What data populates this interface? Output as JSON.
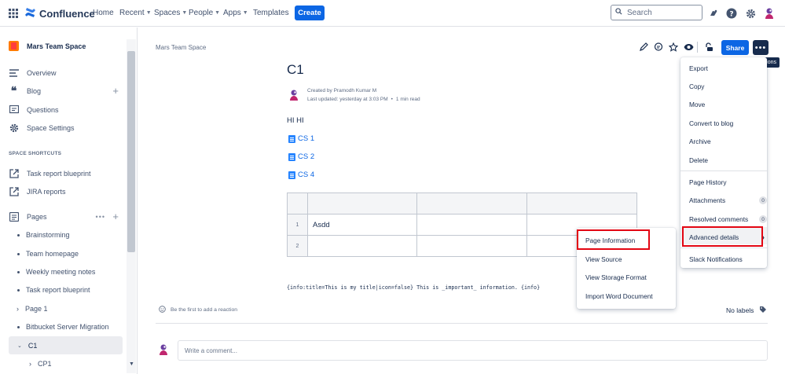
{
  "topbar": {
    "logo": "Confluence",
    "nav": [
      {
        "label": "Home",
        "dropdown": false
      },
      {
        "label": "Recent",
        "dropdown": true
      },
      {
        "label": "Spaces",
        "dropdown": true
      },
      {
        "label": "People",
        "dropdown": true
      },
      {
        "label": "Apps",
        "dropdown": true
      },
      {
        "label": "Templates",
        "dropdown": false
      }
    ],
    "create_label": "Create",
    "search_placeholder": "Search"
  },
  "sidebar": {
    "space_name": "Mars Team Space",
    "items": [
      {
        "label": "Overview",
        "icon": "overview-icon"
      },
      {
        "label": "Blog",
        "icon": "quote-icon"
      },
      {
        "label": "Questions",
        "icon": "questions-icon"
      },
      {
        "label": "Space Settings",
        "icon": "gear-icon"
      }
    ],
    "shortcuts_header": "SPACE SHORTCUTS",
    "shortcuts": [
      "Task report blueprint",
      "JIRA reports"
    ],
    "pages_label": "Pages",
    "tree": [
      {
        "label": "Brainstorming",
        "type": "bullet"
      },
      {
        "label": "Team homepage",
        "type": "bullet"
      },
      {
        "label": "Weekly meeting notes",
        "type": "bullet"
      },
      {
        "label": "Task report blueprint",
        "type": "bullet"
      },
      {
        "label": "Page 1",
        "type": "collapsed"
      },
      {
        "label": "Bitbucket Server Migration",
        "type": "bullet"
      },
      {
        "label": "C1",
        "type": "expanded"
      },
      {
        "label": "CP1",
        "type": "collapsed"
      }
    ]
  },
  "page": {
    "breadcrumb": "Mars Team Space",
    "title": "C1",
    "created_by": "Created by Pramodh Kumar M",
    "last_updated": "Last updated: yesterday at 3:03 PM",
    "read_time": "1 min read",
    "body_text": "HI HI",
    "child_links": [
      "CS 1",
      "CS 2",
      "CS 4"
    ],
    "table": {
      "rows": [
        [
          "",
          "",
          "",
          ""
        ],
        [
          "1",
          "Asdd",
          "",
          ""
        ],
        [
          "2",
          "",
          "",
          ""
        ]
      ]
    },
    "macro_text": "{info:title=This is my title|icon=false} This is _important_ information. {info}",
    "reaction_text": "Be the first to add a reaction",
    "labels_text": "No labels",
    "comment_placeholder": "Write a comment..."
  },
  "actions": {
    "share_label": "Share",
    "more_label": "•••",
    "tooltip": "More actions"
  },
  "more_menu": {
    "items": [
      "Export",
      "Copy",
      "Move",
      "Convert to blog",
      "Archive",
      "Delete"
    ],
    "items2": [
      "Page History",
      "Attachments",
      "Resolved comments",
      "Advanced details",
      "Slack Notifications"
    ],
    "attachments_count": "0",
    "resolved_count": "0"
  },
  "submenu": {
    "items": [
      "Page Information",
      "View Source",
      "View Storage Format",
      "Import Word Document"
    ]
  },
  "colors": {
    "accent": "#0c66e4",
    "highlight_box": "#e30613",
    "dark": "#172b4d"
  }
}
